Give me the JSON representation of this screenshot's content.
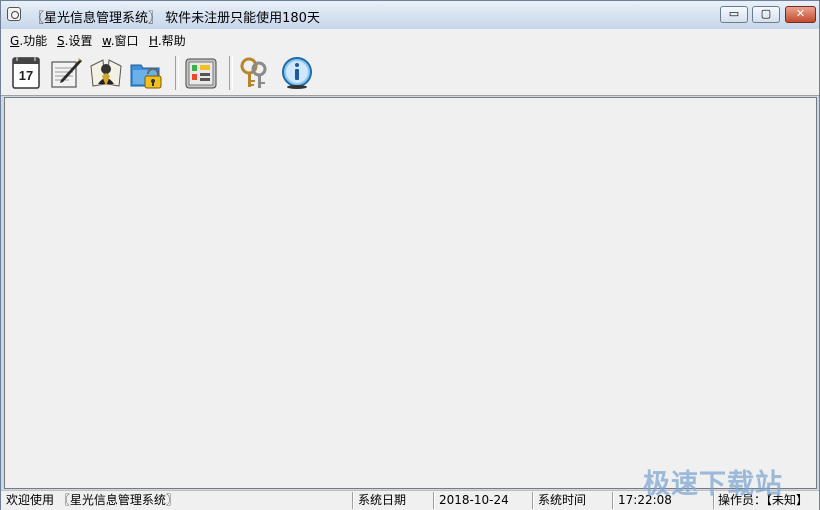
{
  "window": {
    "title": "〖星光信息管理系统〗  软件未注册只能使用180天",
    "minimize_glyph": "▭",
    "maximize_glyph": "▢",
    "close_glyph": "✕"
  },
  "menu": [
    {
      "key": "G",
      "label": ".功能"
    },
    {
      "key": "S",
      "label": ".设置"
    },
    {
      "key": "w",
      "label": ".窗口"
    },
    {
      "key": "H",
      "label": ".帮助"
    }
  ],
  "toolbar": {
    "calendar_day": "17",
    "icons": [
      "calendar-icon",
      "notepad-pen-icon",
      "address-book-icon",
      "lock-folder-icon",
      "settings-panel-icon",
      "keys-icon",
      "info-icon"
    ]
  },
  "statusbar": {
    "welcome": "欢迎使用 〖星光信息管理系统〗",
    "date_label": "系统日期",
    "date_value": "2018-10-24",
    "time_label": "系统时间",
    "time_value": "17:22:08",
    "operator": "操作员：【未知】"
  },
  "watermark": "极速下载站",
  "colors": {
    "accent": "#3b7dc4",
    "close": "#c34a2c",
    "watermark": "#7fa7d1"
  }
}
